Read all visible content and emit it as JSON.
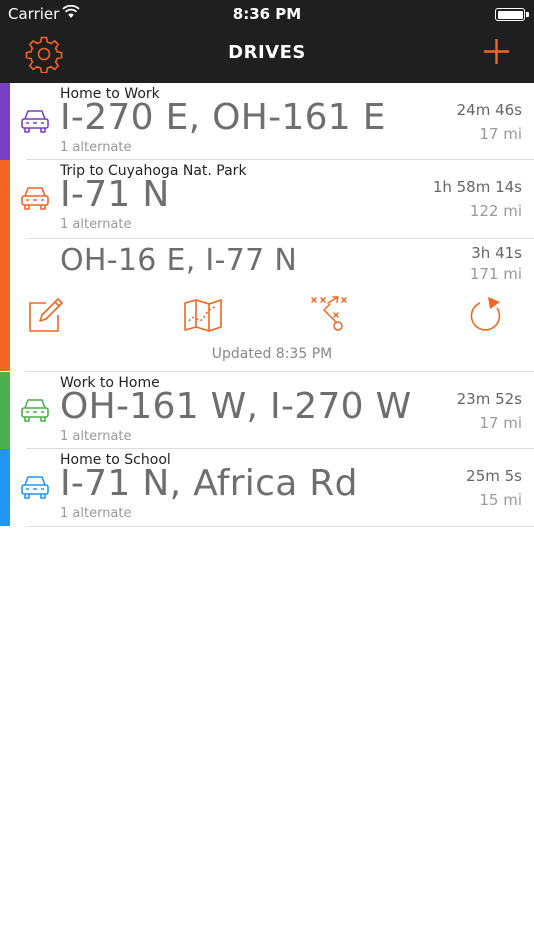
{
  "status": {
    "carrier": "Carrier",
    "time": "8:36 PM"
  },
  "nav": {
    "title": "DRIVES"
  },
  "colors": {
    "accent": "#f26522",
    "purple": "#7b3fc4",
    "orange": "#f26522",
    "green": "#4cae4c",
    "blue": "#2196f3"
  },
  "drives": [
    {
      "name": "Home to Work",
      "route": "I-270 E, OH-161 E",
      "alternates": "1 alternate",
      "duration": "24m 46s",
      "distance": "17 mi"
    },
    {
      "name": "Trip to Cuyahoga Nat. Park",
      "route": "I-71 N",
      "alternates": "1 alternate",
      "duration": "1h 58m 14s",
      "distance": "122 mi",
      "alternate_route": {
        "route": "OH-16 E, I-77 N",
        "duration": "3h 41s",
        "distance": "171 mi"
      },
      "updated": "Updated 8:35 PM"
    },
    {
      "name": "Work to Home",
      "route": "OH-161 W, I-270 W",
      "alternates": "1 alternate",
      "duration": "23m 52s",
      "distance": "17 mi"
    },
    {
      "name": "Home to School",
      "route": "I-71 N, Africa Rd",
      "alternates": "1 alternate",
      "duration": "25m 5s",
      "distance": "15 mi"
    }
  ]
}
